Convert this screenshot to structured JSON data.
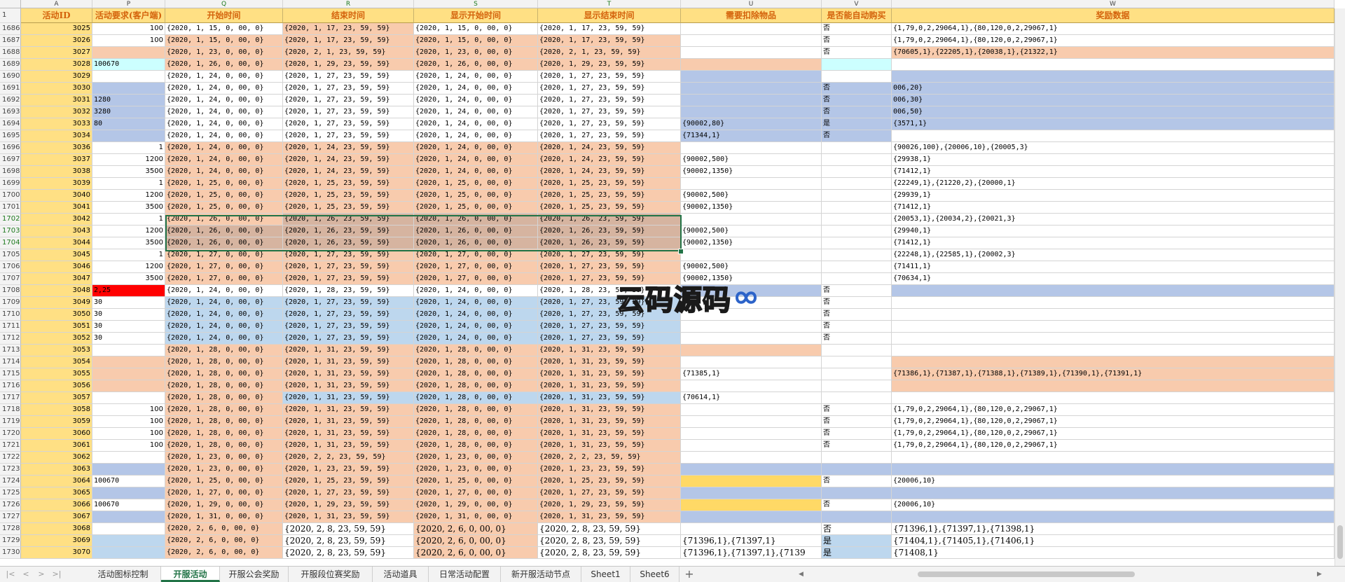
{
  "colors": {
    "header_bg": "#ffe084",
    "header_text": "#d4630c",
    "orange": "#f8cbad",
    "blue": "#b4c6e7",
    "light_blue": "#bdd7ee",
    "cyan": "#ccffff",
    "red": "#ff0000",
    "brown": "#d6b4a0",
    "yellow": "#ffd966",
    "white": "#ffffff",
    "selection": "#217346"
  },
  "column_letters": [
    "A",
    "P",
    "Q",
    "R",
    "S",
    "T",
    "U",
    "V",
    "W"
  ],
  "headers": [
    "活动ID",
    "活动要求(客户端)",
    "开始时间",
    "结束时间",
    "显示开始时间",
    "显示结束时间",
    "需要扣除物品",
    "是否能自动购买",
    "奖励数据"
  ],
  "first_row_label": "1",
  "rows": [
    {
      "n": "1686",
      "c": [
        "3025",
        "100",
        "{2020, 1, 15, 0, 00, 0}",
        "{2020, 1, 17, 23, 59, 59}",
        "{2020, 1, 15, 0, 00, 0}",
        "{2020, 1, 17, 23, 59, 59}",
        "",
        "否",
        "{1,79,0,2,29064,1},{80,120,0,2,29067,1}"
      ],
      "bg": [
        "y",
        "w",
        "w",
        "o",
        "w",
        "w",
        "w",
        "w",
        "w"
      ]
    },
    {
      "n": "1687",
      "c": [
        "3026",
        "100",
        "{2020, 1, 15, 0, 00, 0}",
        "{2020, 1, 17, 23, 59, 59}",
        "{2020, 1, 15, 0, 00, 0}",
        "{2020, 1, 17, 23, 59, 59}",
        "",
        "否",
        "{1,79,0,2,29064,1},{80,120,0,2,29067,1}"
      ],
      "bg": [
        "y",
        "w",
        "o",
        "o",
        "o",
        "o",
        "w",
        "w",
        "w"
      ]
    },
    {
      "n": "1688",
      "c": [
        "3027",
        "",
        "{2020, 1, 23, 0, 00, 0}",
        "{2020, 2, 1, 23, 59, 59}",
        "{2020, 1, 23, 0, 00, 0}",
        "{2020, 2, 1, 23, 59, 59}",
        "",
        "否",
        "{70605,1},{22205,1},{20038,1},{21322,1}"
      ],
      "bg": [
        "y",
        "o",
        "o",
        "o",
        "o",
        "o",
        "w",
        "w",
        "o"
      ]
    },
    {
      "n": "1689",
      "c": [
        "3028",
        "100670",
        "{2020, 1, 26, 0, 00, 0}",
        "{2020, 1, 29, 23, 59, 59}",
        "{2020, 1, 26, 0, 00, 0}",
        "{2020, 1, 29, 23, 59, 59}",
        "",
        "",
        ""
      ],
      "bg": [
        "y",
        "c",
        "o",
        "o",
        "o",
        "o",
        "o",
        "c",
        "w"
      ]
    },
    {
      "n": "1690",
      "c": [
        "3029",
        "",
        "{2020, 1, 24, 0, 00, 0}",
        "{2020, 1, 27, 23, 59, 59}",
        "{2020, 1, 24, 0, 00, 0}",
        "{2020, 1, 27, 23, 59, 59}",
        "",
        "",
        ""
      ],
      "bg": [
        "y",
        "w",
        "w",
        "w",
        "w",
        "w",
        "b",
        "w",
        "b"
      ]
    },
    {
      "n": "1691",
      "c": [
        "3030",
        "",
        "{2020, 1, 24, 0, 00, 0}",
        "{2020, 1, 27, 23, 59, 59}",
        "{2020, 1, 24, 0, 00, 0}",
        "{2020, 1, 27, 23, 59, 59}",
        "",
        "否",
        "006,20}"
      ],
      "bg": [
        "y",
        "b",
        "w",
        "w",
        "w",
        "w",
        "b",
        "b",
        "b"
      ]
    },
    {
      "n": "1692",
      "c": [
        "3031",
        "1280",
        "{2020, 1, 24, 0, 00, 0}",
        "{2020, 1, 27, 23, 59, 59}",
        "{2020, 1, 24, 0, 00, 0}",
        "{2020, 1, 27, 23, 59, 59}",
        "",
        "否",
        "006,30}"
      ],
      "bg": [
        "y",
        "b",
        "w",
        "w",
        "w",
        "w",
        "b",
        "b",
        "b"
      ]
    },
    {
      "n": "1693",
      "c": [
        "3032",
        "3280",
        "{2020, 1, 24, 0, 00, 0}",
        "{2020, 1, 27, 23, 59, 59}",
        "{2020, 1, 24, 0, 00, 0}",
        "{2020, 1, 27, 23, 59, 59}",
        "",
        "否",
        "006,50}"
      ],
      "bg": [
        "y",
        "b",
        "w",
        "w",
        "w",
        "w",
        "b",
        "b",
        "b"
      ]
    },
    {
      "n": "1694",
      "c": [
        "3033",
        "80",
        "{2020, 1, 24, 0, 00, 0}",
        "{2020, 1, 27, 23, 59, 59}",
        "{2020, 1, 24, 0, 00, 0}",
        "{2020, 1, 27, 23, 59, 59}",
        "{90002,80}",
        "是",
        "{3571,1}"
      ],
      "bg": [
        "y",
        "b",
        "w",
        "w",
        "w",
        "w",
        "b",
        "b",
        "b"
      ]
    },
    {
      "n": "1695",
      "c": [
        "3034",
        "",
        "{2020, 1, 24, 0, 00, 0}",
        "{2020, 1, 27, 23, 59, 59}",
        "{2020, 1, 24, 0, 00, 0}",
        "{2020, 1, 27, 23, 59, 59}",
        "{71344,1}",
        "否",
        ""
      ],
      "bg": [
        "y",
        "b",
        "w",
        "w",
        "w",
        "w",
        "b",
        "b",
        "w"
      ]
    },
    {
      "n": "1696",
      "c": [
        "3036",
        "1",
        "{2020, 1, 24, 0, 00, 0}",
        "{2020, 1, 24, 23, 59, 59}",
        "{2020, 1, 24, 0, 00, 0}",
        "{2020, 1, 24, 23, 59, 59}",
        "",
        "",
        "{90026,100},{20006,10},{20005,3}"
      ],
      "bg": [
        "y",
        "w",
        "o",
        "o",
        "o",
        "o",
        "w",
        "w",
        "w"
      ]
    },
    {
      "n": "1697",
      "c": [
        "3037",
        "1200",
        "{2020, 1, 24, 0, 00, 0}",
        "{2020, 1, 24, 23, 59, 59}",
        "{2020, 1, 24, 0, 00, 0}",
        "{2020, 1, 24, 23, 59, 59}",
        "{90002,500}",
        "",
        "{29938,1}"
      ],
      "bg": [
        "y",
        "w",
        "o",
        "o",
        "o",
        "o",
        "w",
        "w",
        "w"
      ]
    },
    {
      "n": "1698",
      "c": [
        "3038",
        "3500",
        "{2020, 1, 24, 0, 00, 0}",
        "{2020, 1, 24, 23, 59, 59}",
        "{2020, 1, 24, 0, 00, 0}",
        "{2020, 1, 24, 23, 59, 59}",
        "{90002,1350}",
        "",
        "{71412,1}"
      ],
      "bg": [
        "y",
        "w",
        "o",
        "o",
        "o",
        "o",
        "w",
        "w",
        "w"
      ]
    },
    {
      "n": "1699",
      "c": [
        "3039",
        "1",
        "{2020, 1, 25, 0, 00, 0}",
        "{2020, 1, 25, 23, 59, 59}",
        "{2020, 1, 25, 0, 00, 0}",
        "{2020, 1, 25, 23, 59, 59}",
        "",
        "",
        "{22249,1},{21220,2},{20000,1}"
      ],
      "bg": [
        "y",
        "w",
        "o",
        "o",
        "o",
        "o",
        "w",
        "w",
        "w"
      ]
    },
    {
      "n": "1700",
      "c": [
        "3040",
        "1200",
        "{2020, 1, 25, 0, 00, 0}",
        "{2020, 1, 25, 23, 59, 59}",
        "{2020, 1, 25, 0, 00, 0}",
        "{2020, 1, 25, 23, 59, 59}",
        "{90002,500}",
        "",
        "{29939,1}"
      ],
      "bg": [
        "y",
        "w",
        "o",
        "o",
        "o",
        "o",
        "w",
        "w",
        "w"
      ]
    },
    {
      "n": "1701",
      "c": [
        "3041",
        "3500",
        "{2020, 1, 25, 0, 00, 0}",
        "{2020, 1, 25, 23, 59, 59}",
        "{2020, 1, 25, 0, 00, 0}",
        "{2020, 1, 25, 23, 59, 59}",
        "{90002,1350}",
        "",
        "{71412,1}"
      ],
      "bg": [
        "y",
        "w",
        "o",
        "o",
        "o",
        "o",
        "w",
        "w",
        "w"
      ]
    },
    {
      "n": "1702",
      "c": [
        "3042",
        "1",
        "{2020, 1, 26, 0, 00, 0}",
        "{2020, 1, 26, 23, 59, 59}",
        "{2020, 1, 26, 0, 00, 0}",
        "{2020, 1, 26, 23, 59, 59}",
        "",
        "",
        "{20053,1},{20034,2},{20021,3}"
      ],
      "bg": [
        "y",
        "w",
        "o",
        "n",
        "n",
        "n",
        "w",
        "w",
        "w"
      ],
      "sel": true
    },
    {
      "n": "1703",
      "c": [
        "3043",
        "1200",
        "{2020, 1, 26, 0, 00, 0}",
        "{2020, 1, 26, 23, 59, 59}",
        "{2020, 1, 26, 0, 00, 0}",
        "{2020, 1, 26, 23, 59, 59}",
        "{90002,500}",
        "",
        "{29940,1}"
      ],
      "bg": [
        "y",
        "w",
        "n",
        "n",
        "n",
        "n",
        "w",
        "w",
        "w"
      ],
      "sel": true
    },
    {
      "n": "1704",
      "c": [
        "3044",
        "3500",
        "{2020, 1, 26, 0, 00, 0}",
        "{2020, 1, 26, 23, 59, 59}",
        "{2020, 1, 26, 0, 00, 0}",
        "{2020, 1, 26, 23, 59, 59}",
        "{90002,1350}",
        "",
        "{71412,1}"
      ],
      "bg": [
        "y",
        "w",
        "n",
        "n",
        "n",
        "n",
        "w",
        "w",
        "w"
      ],
      "sel": true
    },
    {
      "n": "1705",
      "c": [
        "3045",
        "1",
        "{2020, 1, 27, 0, 00, 0}",
        "{2020, 1, 27, 23, 59, 59}",
        "{2020, 1, 27, 0, 00, 0}",
        "{2020, 1, 27, 23, 59, 59}",
        "",
        "",
        "{22248,1},{22585,1},{20002,3}"
      ],
      "bg": [
        "y",
        "w",
        "o",
        "o",
        "o",
        "o",
        "w",
        "w",
        "w"
      ]
    },
    {
      "n": "1706",
      "c": [
        "3046",
        "1200",
        "{2020, 1, 27, 0, 00, 0}",
        "{2020, 1, 27, 23, 59, 59}",
        "{2020, 1, 27, 0, 00, 0}",
        "{2020, 1, 27, 23, 59, 59}",
        "{90002,500}",
        "",
        "{71411,1}"
      ],
      "bg": [
        "y",
        "w",
        "o",
        "o",
        "o",
        "o",
        "w",
        "w",
        "w"
      ]
    },
    {
      "n": "1707",
      "c": [
        "3047",
        "3500",
        "{2020, 1, 27, 0, 00, 0}",
        "{2020, 1, 27, 23, 59, 59}",
        "{2020, 1, 27, 0, 00, 0}",
        "{2020, 1, 27, 23, 59, 59}",
        "{90002,1350}",
        "",
        "{70634,1}"
      ],
      "bg": [
        "y",
        "w",
        "o",
        "o",
        "o",
        "o",
        "w",
        "w",
        "w"
      ]
    },
    {
      "n": "1708",
      "c": [
        "3048",
        "2,25",
        "{2020, 1, 24, 0, 00, 0}",
        "{2020, 1, 28, 23, 59, 59}",
        "{2020, 1, 24, 0, 00, 0}",
        "{2020, 1, 28, 23, 59, 59}",
        "",
        "否",
        ""
      ],
      "bg": [
        "y",
        "r",
        "w",
        "w",
        "w",
        "w",
        "b",
        "w",
        "b"
      ]
    },
    {
      "n": "1709",
      "c": [
        "3049",
        "30",
        "{2020, 1, 24, 0, 00, 0}",
        "{2020, 1, 27, 23, 59, 59}",
        "{2020, 1, 24, 0, 00, 0}",
        "{2020, 1, 27, 23, 59, 59}",
        "",
        "否",
        ""
      ],
      "bg": [
        "y",
        "w",
        "l",
        "l",
        "l",
        "l",
        "w",
        "w",
        "w"
      ]
    },
    {
      "n": "1710",
      "c": [
        "3050",
        "30",
        "{2020, 1, 24, 0, 00, 0}",
        "{2020, 1, 27, 23, 59, 59}",
        "{2020, 1, 24, 0, 00, 0}",
        "{2020, 1, 27, 23, 59, 59}",
        "",
        "否",
        ""
      ],
      "bg": [
        "y",
        "w",
        "l",
        "l",
        "l",
        "l",
        "w",
        "w",
        "w"
      ]
    },
    {
      "n": "1711",
      "c": [
        "3051",
        "30",
        "{2020, 1, 24, 0, 00, 0}",
        "{2020, 1, 27, 23, 59, 59}",
        "{2020, 1, 24, 0, 00, 0}",
        "{2020, 1, 27, 23, 59, 59}",
        "",
        "否",
        ""
      ],
      "bg": [
        "y",
        "w",
        "l",
        "l",
        "l",
        "l",
        "w",
        "w",
        "w"
      ]
    },
    {
      "n": "1712",
      "c": [
        "3052",
        "30",
        "{2020, 1, 24, 0, 00, 0}",
        "{2020, 1, 27, 23, 59, 59}",
        "{2020, 1, 24, 0, 00, 0}",
        "{2020, 1, 27, 23, 59, 59}",
        "",
        "否",
        ""
      ],
      "bg": [
        "y",
        "w",
        "l",
        "l",
        "l",
        "l",
        "w",
        "w",
        "w"
      ]
    },
    {
      "n": "1713",
      "c": [
        "3053",
        "",
        "{2020, 1, 28, 0, 00, 0}",
        "{2020, 1, 31, 23, 59, 59}",
        "{2020, 1, 28, 0, 00, 0}",
        "{2020, 1, 31, 23, 59, 59}",
        "",
        "",
        ""
      ],
      "bg": [
        "y",
        "w",
        "o",
        "o",
        "o",
        "o",
        "o",
        "w",
        "w"
      ]
    },
    {
      "n": "1714",
      "c": [
        "3054",
        "",
        "{2020, 1, 28, 0, 00, 0}",
        "{2020, 1, 31, 23, 59, 59}",
        "{2020, 1, 28, 0, 00, 0}",
        "{2020, 1, 31, 23, 59, 59}",
        "",
        "",
        ""
      ],
      "bg": [
        "y",
        "o",
        "o",
        "o",
        "o",
        "o",
        "w",
        "w",
        "o"
      ]
    },
    {
      "n": "1715",
      "c": [
        "3055",
        "",
        "{2020, 1, 28, 0, 00, 0}",
        "{2020, 1, 31, 23, 59, 59}",
        "{2020, 1, 28, 0, 00, 0}",
        "{2020, 1, 31, 23, 59, 59}",
        "{71385,1}",
        "",
        "{71386,1},{71387,1},{71388,1},{71389,1},{71390,1},{71391,1}"
      ],
      "bg": [
        "y",
        "o",
        "o",
        "o",
        "o",
        "o",
        "w",
        "w",
        "o"
      ]
    },
    {
      "n": "1716",
      "c": [
        "3056",
        "",
        "{2020, 1, 28, 0, 00, 0}",
        "{2020, 1, 31, 23, 59, 59}",
        "{2020, 1, 28, 0, 00, 0}",
        "{2020, 1, 31, 23, 59, 59}",
        "",
        "",
        ""
      ],
      "bg": [
        "y",
        "o",
        "o",
        "o",
        "o",
        "o",
        "w",
        "w",
        "o"
      ]
    },
    {
      "n": "1717",
      "c": [
        "3057",
        "",
        "{2020, 1, 28, 0, 00, 0}",
        "{2020, 1, 31, 23, 59, 59}",
        "{2020, 1, 28, 0, 00, 0}",
        "{2020, 1, 31, 23, 59, 59}",
        "{70614,1}",
        "",
        ""
      ],
      "bg": [
        "y",
        "w",
        "o",
        "l",
        "l",
        "l",
        "w",
        "w",
        "w"
      ]
    },
    {
      "n": "1718",
      "c": [
        "3058",
        "100",
        "{2020, 1, 28, 0, 00, 0}",
        "{2020, 1, 31, 23, 59, 59}",
        "{2020, 1, 28, 0, 00, 0}",
        "{2020, 1, 31, 23, 59, 59}",
        "",
        "否",
        "{1,79,0,2,29064,1},{80,120,0,2,29067,1}"
      ],
      "bg": [
        "y",
        "w",
        "o",
        "o",
        "o",
        "o",
        "w",
        "w",
        "w"
      ]
    },
    {
      "n": "1719",
      "c": [
        "3059",
        "100",
        "{2020, 1, 28, 0, 00, 0}",
        "{2020, 1, 31, 23, 59, 59}",
        "{2020, 1, 28, 0, 00, 0}",
        "{2020, 1, 31, 23, 59, 59}",
        "",
        "否",
        "{1,79,0,2,29064,1},{80,120,0,2,29067,1}"
      ],
      "bg": [
        "y",
        "w",
        "o",
        "o",
        "o",
        "o",
        "w",
        "w",
        "w"
      ]
    },
    {
      "n": "1720",
      "c": [
        "3060",
        "100",
        "{2020, 1, 28, 0, 00, 0}",
        "{2020, 1, 31, 23, 59, 59}",
        "{2020, 1, 28, 0, 00, 0}",
        "{2020, 1, 31, 23, 59, 59}",
        "",
        "否",
        "{1,79,0,2,29064,1},{80,120,0,2,29067,1}"
      ],
      "bg": [
        "y",
        "w",
        "o",
        "o",
        "o",
        "o",
        "w",
        "w",
        "w"
      ]
    },
    {
      "n": "1721",
      "c": [
        "3061",
        "100",
        "{2020, 1, 28, 0, 00, 0}",
        "{2020, 1, 31, 23, 59, 59}",
        "{2020, 1, 28, 0, 00, 0}",
        "{2020, 1, 31, 23, 59, 59}",
        "",
        "否",
        "{1,79,0,2,29064,1},{80,120,0,2,29067,1}"
      ],
      "bg": [
        "y",
        "w",
        "o",
        "o",
        "o",
        "o",
        "w",
        "w",
        "w"
      ]
    },
    {
      "n": "1722",
      "c": [
        "3062",
        "",
        "{2020, 1, 23, 0, 00, 0}",
        "{2020, 2, 2, 23, 59, 59}",
        "{2020, 1, 23, 0, 00, 0}",
        "{2020, 2, 2, 23, 59, 59}",
        "",
        "",
        ""
      ],
      "bg": [
        "y",
        "w",
        "o",
        "o",
        "o",
        "o",
        "w",
        "w",
        "w"
      ]
    },
    {
      "n": "1723",
      "c": [
        "3063",
        "",
        "{2020, 1, 23, 0, 00, 0}",
        "{2020, 1, 23, 23, 59, 59}",
        "{2020, 1, 23, 0, 00, 0}",
        "{2020, 1, 23, 23, 59, 59}",
        "",
        "",
        ""
      ],
      "bg": [
        "y",
        "b",
        "o",
        "o",
        "o",
        "o",
        "b",
        "b",
        "b"
      ]
    },
    {
      "n": "1724",
      "c": [
        "3064",
        "100670",
        "{2020, 1, 25, 0, 00, 0}",
        "{2020, 1, 25, 23, 59, 59}",
        "{2020, 1, 25, 0, 00, 0}",
        "{2020, 1, 25, 23, 59, 59}",
        "",
        "否",
        "{20006,10}"
      ],
      "bg": [
        "y",
        "w",
        "o",
        "o",
        "o",
        "o",
        "ye",
        "w",
        "w"
      ]
    },
    {
      "n": "1725",
      "c": [
        "3065",
        "",
        "{2020, 1, 27, 0, 00, 0}",
        "{2020, 1, 27, 23, 59, 59}",
        "{2020, 1, 27, 0, 00, 0}",
        "{2020, 1, 27, 23, 59, 59}",
        "",
        "",
        ""
      ],
      "bg": [
        "y",
        "b",
        "o",
        "o",
        "o",
        "o",
        "b",
        "b",
        "b"
      ]
    },
    {
      "n": "1726",
      "c": [
        "3066",
        "100670",
        "{2020, 1, 29, 0, 00, 0}",
        "{2020, 1, 29, 23, 59, 59}",
        "{2020, 1, 29, 0, 00, 0}",
        "{2020, 1, 29, 23, 59, 59}",
        "",
        "否",
        "{20006,10}"
      ],
      "bg": [
        "y",
        "w",
        "o",
        "o",
        "o",
        "o",
        "ye",
        "w",
        "w"
      ]
    },
    {
      "n": "1727",
      "c": [
        "3067",
        "",
        "{2020, 1, 31, 0, 00, 0}",
        "{2020, 1, 31, 23, 59, 59}",
        "{2020, 1, 31, 0, 00, 0}",
        "{2020, 1, 31, 23, 59, 59}",
        "",
        "",
        ""
      ],
      "bg": [
        "y",
        "b",
        "o",
        "o",
        "o",
        "o",
        "b",
        "b",
        "b"
      ]
    },
    {
      "n": "1728",
      "c": [
        "3068",
        "",
        "{2020, 2, 6, 0, 00, 0}",
        "{2020, 2, 8, 23, 59, 59}",
        "{2020, 2, 6, 0, 00, 0}",
        "{2020, 2, 8, 23, 59, 59}",
        "",
        "否",
        "{71396,1},{71397,1},{71398,1}"
      ],
      "bg": [
        "y",
        "w",
        "o",
        "w",
        "o",
        "w",
        "w",
        "w",
        "w"
      ],
      "big": true
    },
    {
      "n": "1729",
      "c": [
        "3069",
        "",
        "{2020, 2, 6, 0, 00, 0}",
        "{2020, 2, 8, 23, 59, 59}",
        "{2020, 2, 6, 0, 00, 0}",
        "{2020, 2, 8, 23, 59, 59}",
        "{71396,1},{71397,1}",
        "是",
        "{71404,1},{71405,1},{71406,1}"
      ],
      "bg": [
        "y",
        "lb",
        "o",
        "w",
        "o",
        "w",
        "w",
        "lb",
        "w"
      ],
      "big": true
    },
    {
      "n": "1730",
      "c": [
        "3070",
        "",
        "{2020, 2, 6, 0, 00, 0}",
        "{2020, 2, 8, 23, 59, 59}",
        "{2020, 2, 6, 0, 00, 0}",
        "{2020, 2, 8, 23, 59, 59}",
        "{71396,1},{71397,1},{7139",
        "是",
        "{71408,1}"
      ],
      "bg": [
        "y",
        "lb",
        "o",
        "w",
        "o",
        "w",
        "w",
        "lb",
        "w"
      ],
      "big": true
    }
  ],
  "watermark": "云码源码",
  "tabs": [
    "活动图标控制",
    "开服活动",
    "开服公会奖励",
    "开服段位赛奖励",
    "活动道具",
    "日常活动配置",
    "新开服活动节点",
    "Sheet1",
    "Sheet6"
  ],
  "active_tab": 1,
  "nav_buttons": [
    "|<",
    "<",
    ">",
    ">|"
  ],
  "add_sheet": "+",
  "scroll_arrows": [
    "◀",
    "▶"
  ]
}
